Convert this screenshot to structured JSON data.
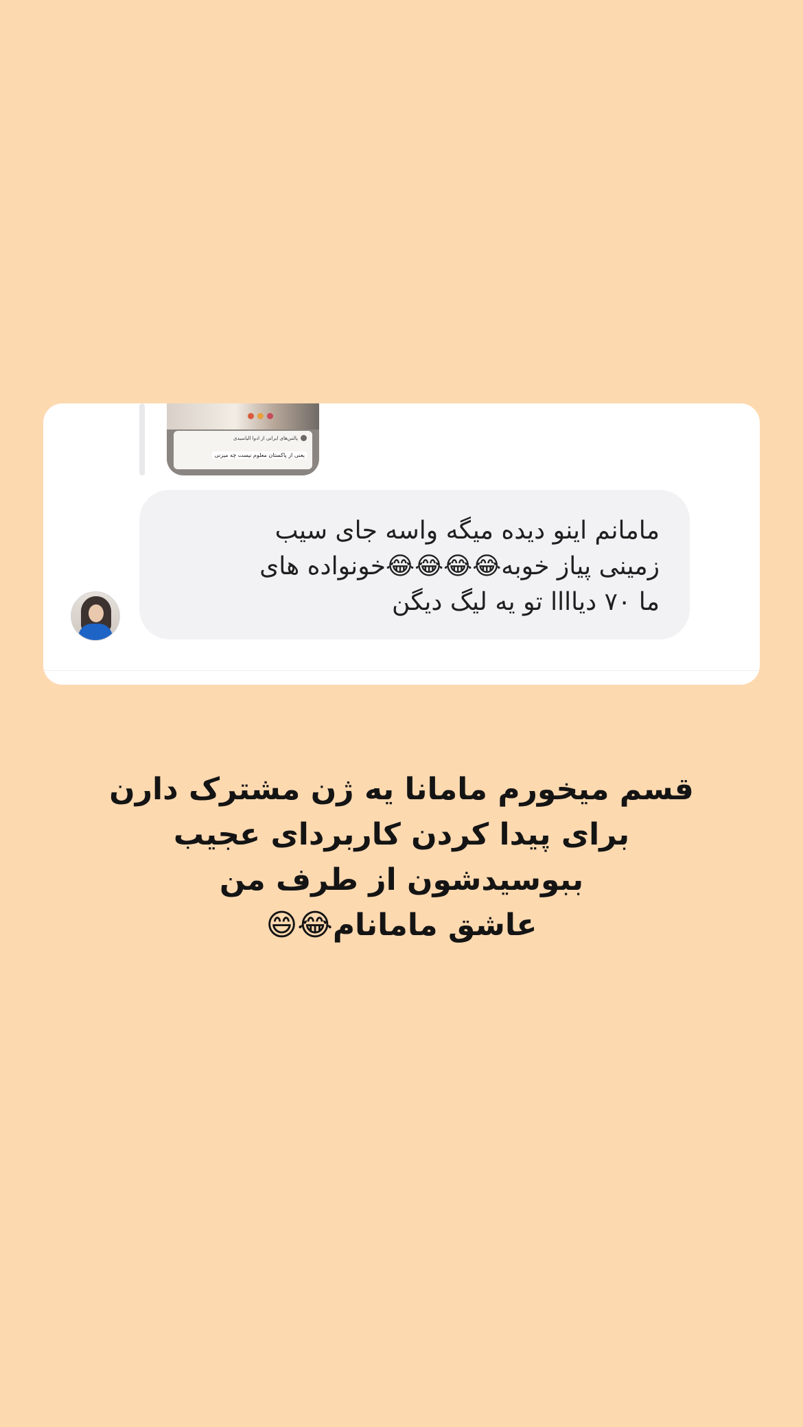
{
  "background_color": "#fdd9b0",
  "story_preview": {
    "username": "پالس‌های ایرانی از ادوا الیاسیدی",
    "caption": "یعنی از پاکستان معلوم نیست چه میزنی"
  },
  "comment": {
    "avatar": "user-avatar",
    "lines": [
      "مامانم اینو دیده میگه واسه جای سیب",
      "زمینی پیاز خوبه😂😂😂😂خونواده های",
      "ما ۷۰ دیاااا تو یه لیگ دیگن"
    ]
  },
  "caption": {
    "lines": [
      "قسم میخورم ماما‌نا یه ژن مشترک دارن",
      "برای پیدا کردن کاربردای عجیب",
      "ببوسیدشون از طرف من",
      "عاشق مامانام😂😄"
    ]
  }
}
